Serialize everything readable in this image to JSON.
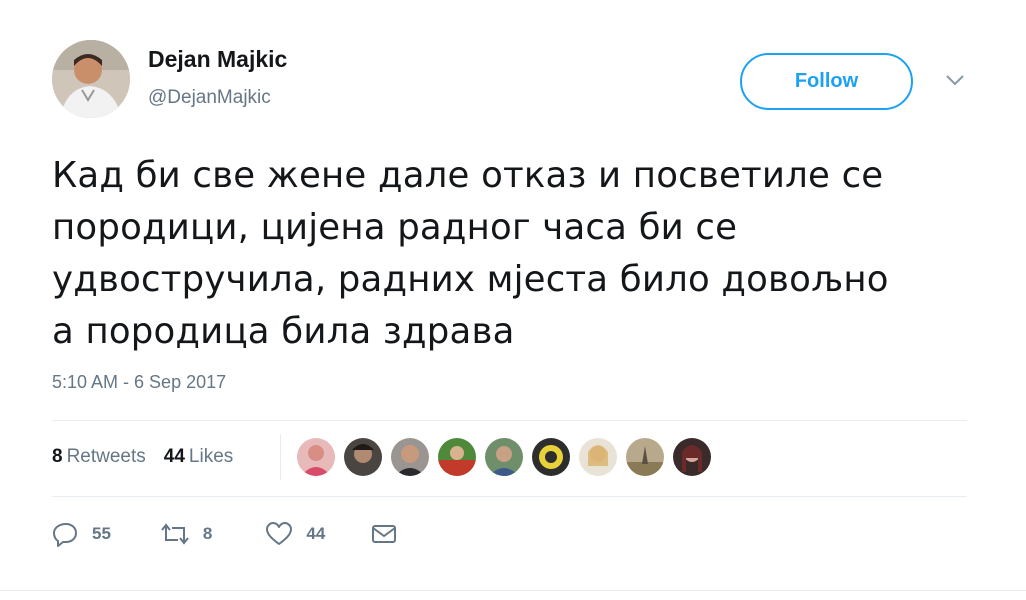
{
  "user": {
    "display_name": "Dejan Majkic",
    "handle": "@DejanMajkic"
  },
  "follow_label": "Follow",
  "tweet": {
    "text": "Кад би све жене дале отказ и посветиле се\nпородици, цијена радног часа би се\nудвостручила, радних мјеста било довољно\nа породица била здрава",
    "timestamp": "5:10 AM - 6 Sep 2017"
  },
  "stats": {
    "retweets_count": "8",
    "retweets_label": "Retweets",
    "likes_count": "44",
    "likes_label": "Likes"
  },
  "actions": {
    "reply_count": "55",
    "retweet_count": "8",
    "like_count": "44"
  },
  "icons": {
    "caret": "chevron-down-icon",
    "reply": "reply-icon",
    "retweet": "retweet-icon",
    "like": "heart-icon",
    "message": "envelope-icon"
  },
  "colors": {
    "accent": "#1da1f2",
    "text": "#14171a",
    "muted": "#657786",
    "divider": "#e6ecf0"
  }
}
